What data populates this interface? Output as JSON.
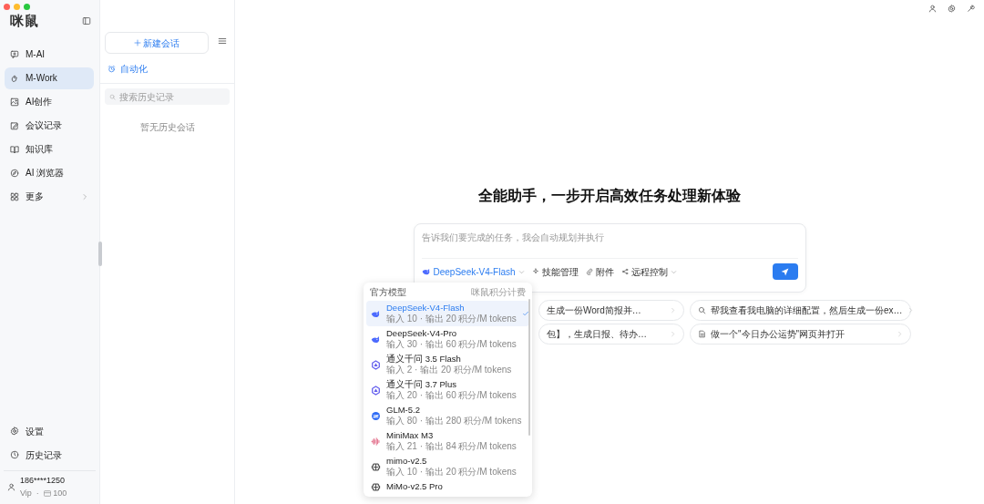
{
  "app": {
    "logo": "咪鼠"
  },
  "nav": [
    {
      "label": "M-AI",
      "selected": false
    },
    {
      "label": "M-Work",
      "selected": true
    },
    {
      "label": "AI创作",
      "selected": false
    },
    {
      "label": "会议记录",
      "selected": false
    },
    {
      "label": "知识库",
      "selected": false
    },
    {
      "label": "AI 浏览器",
      "selected": false
    },
    {
      "label": "更多",
      "selected": false,
      "chevron": true
    }
  ],
  "bottom_nav": [
    {
      "label": "设置"
    },
    {
      "label": "历史记录"
    }
  ],
  "user": {
    "phone": "186****1250",
    "tier": "Vip",
    "separator": "·",
    "credits": "100"
  },
  "history_panel": {
    "new_chat": "新建会话",
    "automation": "自动化",
    "search_placeholder": "搜索历史记录",
    "empty": "暂无历史会话"
  },
  "main": {
    "heading": "全能助手，一步开启高效任务处理新体验",
    "input_placeholder": "告诉我们要完成的任务，我会自动规划并执行",
    "model": "DeepSeek-V4-Flash",
    "tools": [
      {
        "label": "技能管理",
        "caret": false
      },
      {
        "label": "附件",
        "caret": false
      },
      {
        "label": "远程控制",
        "caret": true
      }
    ],
    "suggestions": [
      {
        "text": "生成一份Word简报并…"
      },
      {
        "text": "帮我查看我电脑的详细配置，然后生成一份ex…"
      },
      {
        "text": "包】，生成日报、待办…"
      },
      {
        "text": "做一个\"今日办公运势\"网页并打开"
      }
    ]
  },
  "model_menu": {
    "title": "官方模型",
    "note": "咪鼠积分计费",
    "models": [
      {
        "name": "DeepSeek-V4-Flash",
        "detail": "输入 10 · 输出 20 积分/M tokens",
        "kind": "whale",
        "selected": true
      },
      {
        "name": "DeepSeek-V4-Pro",
        "detail": "输入 30 · 输出 60 积分/M tokens",
        "kind": "whale",
        "selected": false
      },
      {
        "name": "通义千问 3.5 Flash",
        "detail": "输入 2 · 输出 20 积分/M tokens",
        "kind": "hexagon",
        "selected": false
      },
      {
        "name": "通义千问 3.7 Plus",
        "detail": "输入 20 · 输出 60 积分/M tokens",
        "kind": "hexagon",
        "selected": false
      },
      {
        "name": "GLM-5.2",
        "detail": "输入 80 · 输出 280 积分/M tokens",
        "kind": "ring",
        "selected": false
      },
      {
        "name": "MiniMax M3",
        "detail": "输入 21 · 输出 84 积分/M tokens",
        "kind": "wave",
        "selected": false
      },
      {
        "name": "mimo-v2.5",
        "detail": "输入 10 · 输出 20 积分/M tokens",
        "kind": "cube",
        "selected": false
      },
      {
        "name": "MiMo-v2.5 Pro",
        "kind": "cube",
        "selected": false
      }
    ]
  }
}
